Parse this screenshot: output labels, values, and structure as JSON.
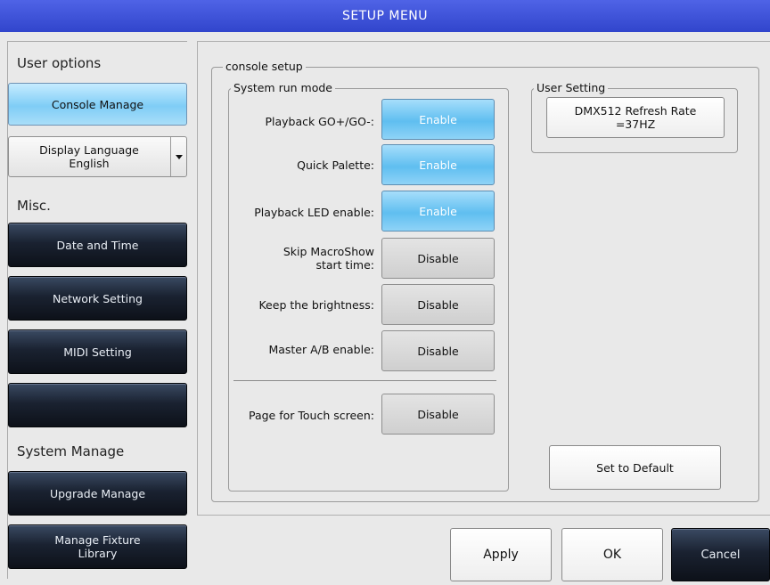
{
  "window": {
    "title": "SETUP MENU"
  },
  "sidebar": {
    "user_options_label": "User options",
    "console_manage": "Console Manage",
    "display_language": {
      "line1": "Display Language",
      "line2": "English"
    },
    "misc_label": "Misc.",
    "date_time": "Date and Time",
    "network_setting": "Network Setting",
    "midi_setting": "MIDI Setting",
    "blank_button": "",
    "system_manage_label": "System Manage",
    "upgrade_manage": "Upgrade Manage",
    "manage_fixture_library": "Manage Fixture\nLibrary"
  },
  "console_setup": {
    "title": "console setup",
    "system_run_mode": {
      "title": "System run mode",
      "rows": [
        {
          "label": "Playback GO+/GO-:",
          "value": "Enable",
          "state": "on"
        },
        {
          "label": "Quick Palette:",
          "value": "Enable",
          "state": "on"
        },
        {
          "label": "Playback LED enable:",
          "value": "Enable",
          "state": "on"
        },
        {
          "label": "Skip MacroShow\nstart time:",
          "value": "Disable",
          "state": "off"
        },
        {
          "label": "Keep the brightness:",
          "value": "Disable",
          "state": "off"
        },
        {
          "label": "Master A/B enable:",
          "value": "Disable",
          "state": "off"
        }
      ],
      "touch_row": {
        "label": "Page for Touch screen:",
        "value": "Disable",
        "state": "off"
      }
    },
    "user_setting": {
      "title": "User Setting",
      "refresh_rate": "DMX512 Refresh Rate\n=37HZ"
    },
    "set_default": "Set to Default"
  },
  "footer": {
    "apply": "Apply",
    "ok": "OK",
    "cancel": "Cancel"
  }
}
